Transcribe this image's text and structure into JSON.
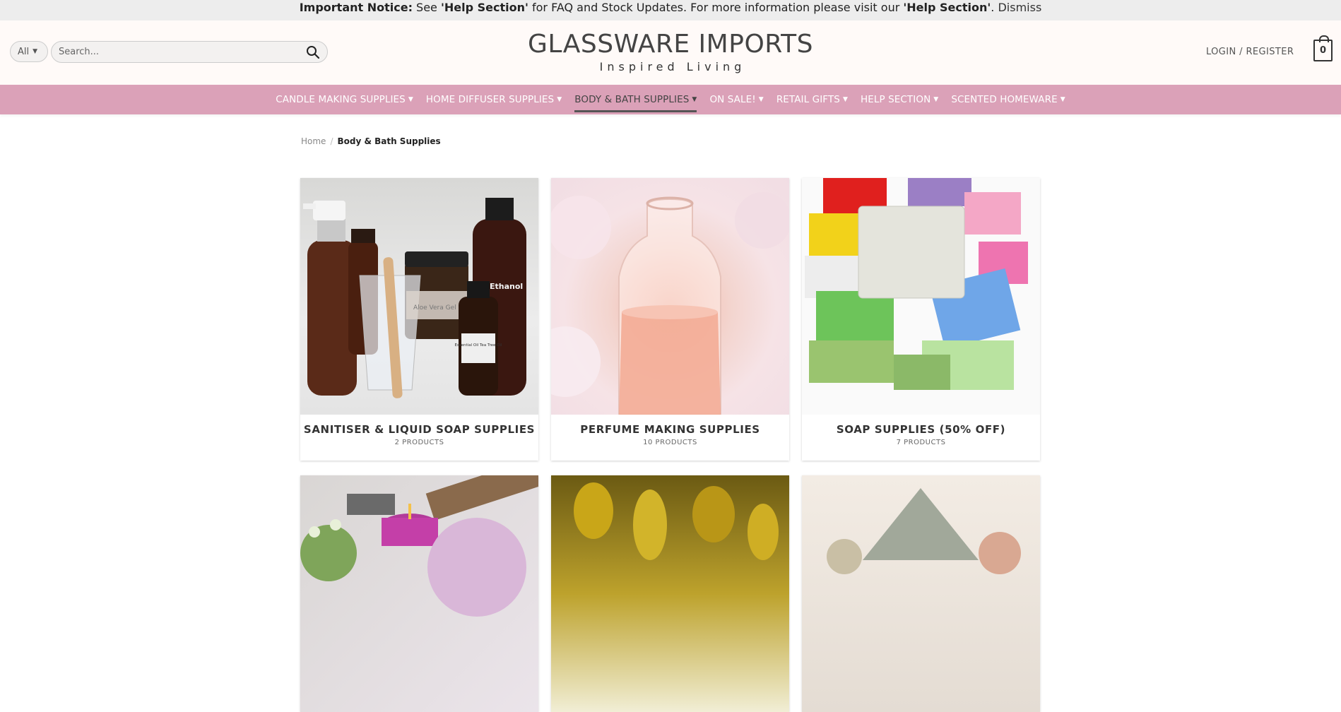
{
  "notice": {
    "label": "Important Notice:",
    "text1": " See ",
    "link1": "'Help Section'",
    "text2": " for FAQ and Stock Updates. For more information please visit our ",
    "link2": "'Help Section'",
    "text3": ". ",
    "dismiss": "Dismiss"
  },
  "header": {
    "category_select": "All",
    "search_placeholder": "Search...",
    "logo_title": "GLASSWARE IMPORTS",
    "logo_subtitle": "Inspired Living",
    "login": "LOGIN / REGISTER",
    "cart_count": "0"
  },
  "nav": {
    "items": [
      {
        "label": "CANDLE MAKING SUPPLIES"
      },
      {
        "label": "HOME DIFFUSER SUPPLIES"
      },
      {
        "label": "BODY & BATH SUPPLIES"
      },
      {
        "label": "ON SALE!"
      },
      {
        "label": "RETAIL GIFTS"
      },
      {
        "label": "HELP SECTION"
      },
      {
        "label": "SCENTED HOMEWARE"
      }
    ],
    "active_index": 2
  },
  "breadcrumb": {
    "home": "Home",
    "separator": "/",
    "current": "Body & Bath Supplies"
  },
  "categories": [
    {
      "title": "SANITISER & LIQUID SOAP SUPPLIES",
      "count": "2 PRODUCTS",
      "image": "sanitiser-bottles"
    },
    {
      "title": "PERFUME MAKING SUPPLIES",
      "count": "10 PRODUCTS",
      "image": "perfume-bottle"
    },
    {
      "title": "SOAP SUPPLIES (50% OFF)",
      "count": "7 PRODUCTS",
      "image": "soap-bars"
    },
    {
      "title": "",
      "count": "",
      "image": "bath-bombs-candles"
    },
    {
      "title": "",
      "count": "",
      "image": "oil-drops"
    },
    {
      "title": "",
      "count": "",
      "image": "clay-powder"
    }
  ],
  "image_labels": {
    "bottle_label": "Ethanol",
    "small_bottle_label": "Essential Oil Tea Tree Oil",
    "jar_label": "Aloe Vera Gel"
  },
  "colors": {
    "nav_bg": "#dba1b8",
    "notice_bg": "#ededed",
    "header_bg": "#fffaf8"
  }
}
